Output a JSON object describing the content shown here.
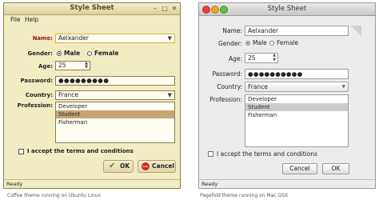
{
  "coffee": {
    "title": "Style Sheet",
    "menu": {
      "file": "File",
      "help": "Help"
    },
    "labels": {
      "name": "Name:",
      "gender": "Gender:",
      "age": "Age:",
      "password": "Password:",
      "country": "Country:",
      "profession": "Profession:"
    },
    "name_value": "Aelxander",
    "gender_options": [
      "Male",
      "Female"
    ],
    "gender_selected": "Male",
    "age_value": "25",
    "password_mask": "●●●●●●●●●",
    "country_value": "France",
    "professions": [
      "Developer",
      "Student",
      "Fisherman"
    ],
    "profession_selected": "Student",
    "terms_label": "I accept the terms and conditions",
    "ok_label": "OK",
    "cancel_label": "Cancel",
    "status": "Ready",
    "caption": "Coffee theme running on Ubuntu Linux",
    "icons": {
      "close": "close-icon",
      "minimize": "minimize-icon",
      "maximize": "maximize-icon",
      "ok": "green-check-icon",
      "cancel": "red-no-icon"
    }
  },
  "pagefold": {
    "title": "Style Sheet",
    "labels": {
      "name": "Name:",
      "gender": "Gender:",
      "age": "Age:",
      "password": "Password:",
      "country": "Country:",
      "profession": "Profession:"
    },
    "name_value": "Aelxander",
    "gender_options": [
      "Male",
      "Female"
    ],
    "gender_selected": "Male",
    "age_value": "25",
    "password_mask": "●●●●●●●●●●",
    "country_value": "France",
    "professions": [
      "Developer",
      "Student",
      "Fisherman"
    ],
    "profession_selected": "Student",
    "terms_label": "I accept the terms and conditions",
    "cancel_label": "Cancel",
    "ok_label": "OK",
    "status": "Ready",
    "caption": "Pagefold theme running on Mac OSX",
    "traffic_light_colors": [
      "#e0443e",
      "#e6a42a",
      "#5fbf3c"
    ]
  },
  "colors": {
    "coffee_bg": "#f1ecc2",
    "coffee_label_red": "#a31212",
    "coffee_selection": "#c8a373",
    "coffee_focus": "#d9b230",
    "pagefold_bg": "#ececec",
    "pagefold_selection": "#cbcbcb"
  }
}
